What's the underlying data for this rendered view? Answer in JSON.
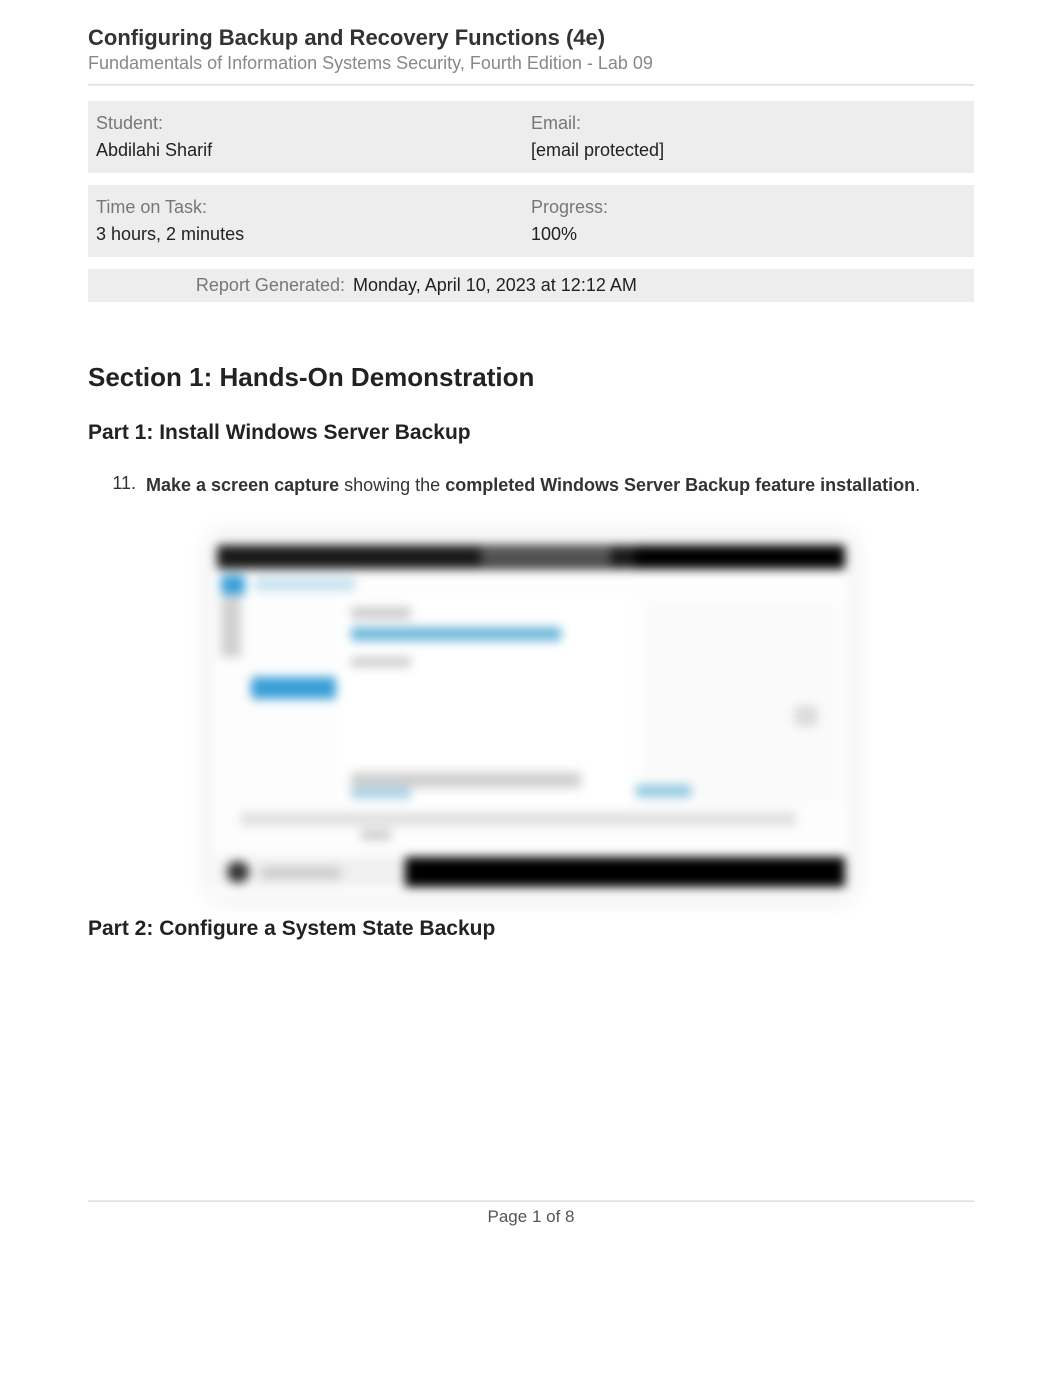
{
  "header": {
    "title": "Configuring Backup and Recovery Functions (4e)",
    "subtitle": "Fundamentals of Information Systems Security, Fourth Edition - Lab 09"
  },
  "info": {
    "student_label": "Student:",
    "student_value": "Abdilahi Sharif",
    "email_label": "Email:",
    "email_value": "[email protected]",
    "time_label": "Time on Task:",
    "time_value": "3 hours, 2 minutes",
    "progress_label": "Progress:",
    "progress_value": "100%"
  },
  "report_generated": {
    "label": "Report Generated:",
    "value": "Monday, April 10, 2023 at 12:12 AM"
  },
  "section1": {
    "title": "Section 1: Hands-On Demonstration",
    "part1_title": "Part 1: Install Windows Server Backup",
    "instruction_num": "11.",
    "instruction_bold1": "Make a screen capture",
    "instruction_mid": " showing the ",
    "instruction_bold2": "completed Windows Server Backup feature installation",
    "instruction_end": ".",
    "part2_title": "Part 2: Configure a System State Backup"
  },
  "footer": {
    "page_text": "Page 1 of 8"
  }
}
